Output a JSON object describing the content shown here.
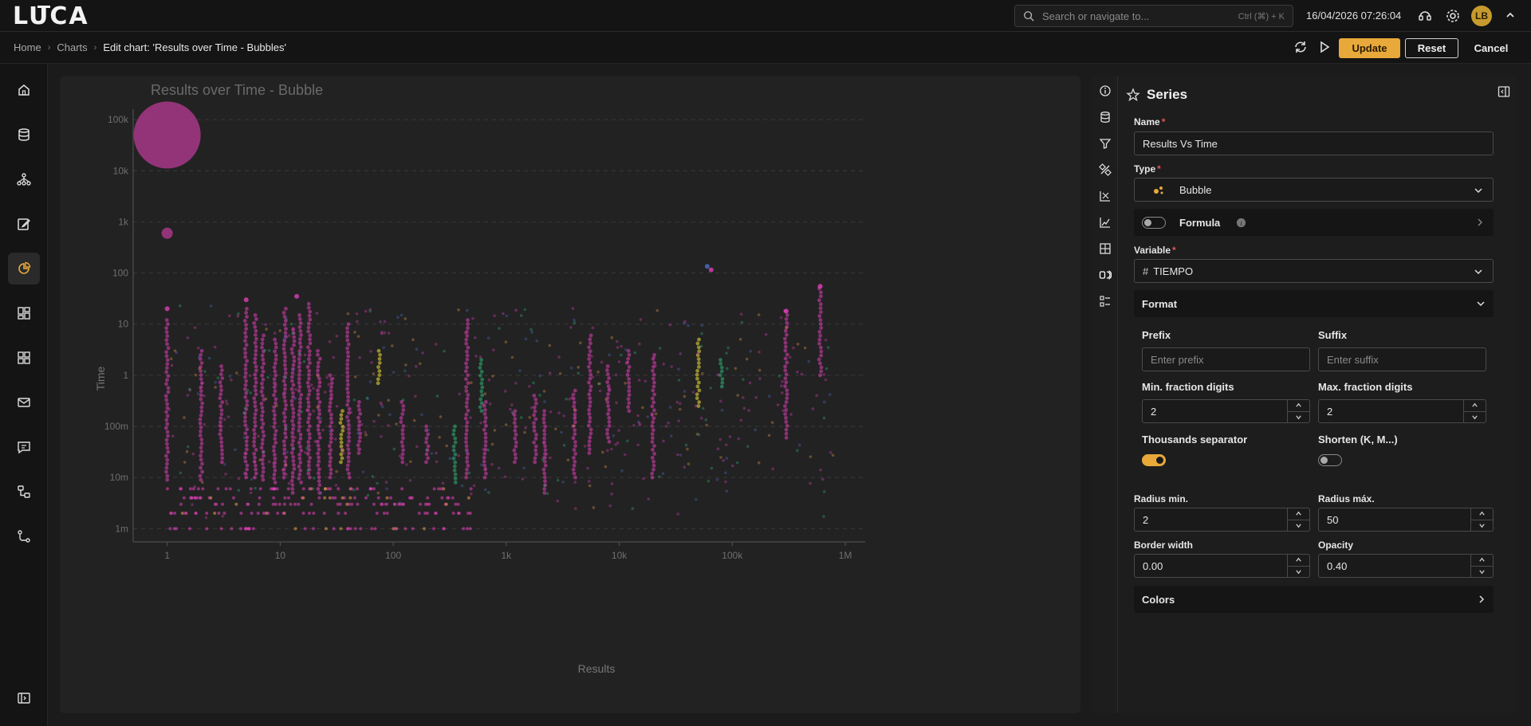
{
  "app": {
    "logo": "LUCA"
  },
  "topbar": {
    "search_placeholder": "Search or navigate to...",
    "search_shortcut": "Ctrl (⌘) + K",
    "datetime": "16/04/2026 07:26:04",
    "avatar_initials": "LB"
  },
  "breadcrumb": {
    "home": "Home",
    "charts": "Charts",
    "current": "Edit chart: 'Results over Time - Bubbles'"
  },
  "toolbar": {
    "update_label": "Update",
    "reset_label": "Reset",
    "cancel_label": "Cancel"
  },
  "chart_data": {
    "type": "scatter",
    "title": "Results over Time - Bubble",
    "xlabel": "Results",
    "ylabel": "Time",
    "xscale": "log",
    "yscale": "log",
    "xlim": [
      0.5,
      1500000
    ],
    "ylim": [
      0.00055,
      160000
    ],
    "x_ticks": [
      "1",
      "10",
      "100",
      "1k",
      "10k",
      "100k",
      "1M"
    ],
    "y_ticks": [
      "100k",
      "10k",
      "1k",
      "100",
      "10",
      "1",
      "100m",
      "10m",
      "1m"
    ],
    "grid": "horizontal-dashed",
    "colors": {
      "magenta": "#e040b8",
      "yellow": "#f2e23a",
      "green": "#2fb57a",
      "blue": "#4a70c8",
      "orange": "#e79a4a",
      "bigbubble": "#b03a8e"
    },
    "bubbles": [
      {
        "x": 1,
        "y": 50000,
        "r": 42,
        "color": "bigbubble"
      },
      {
        "x": 1,
        "y": 600,
        "r": 7,
        "color": "bigbubble"
      },
      {
        "x": 60000,
        "y": 135,
        "r": 3,
        "color": "blue"
      },
      {
        "x": 65000,
        "y": 115,
        "r": 3,
        "color": "magenta"
      },
      {
        "x": 600000,
        "y": 55,
        "r": 3,
        "color": "magenta"
      },
      {
        "x": 300000,
        "y": 18,
        "r": 3,
        "color": "magenta"
      },
      {
        "x": 1,
        "y": 20,
        "r": 3,
        "color": "magenta"
      },
      {
        "x": 5,
        "y": 30,
        "r": 3,
        "color": "magenta"
      },
      {
        "x": 14,
        "y": 35,
        "r": 3,
        "color": "magenta"
      }
    ],
    "columns": [
      {
        "x": 1,
        "ymin": 0.009,
        "ymax": 12,
        "color": "magenta"
      },
      {
        "x": 2,
        "ymin": 0.009,
        "ymax": 3,
        "color": "magenta"
      },
      {
        "x": 3,
        "ymin": 0.02,
        "ymax": 1.5,
        "color": "magenta"
      },
      {
        "x": 5,
        "ymin": 0.01,
        "ymax": 20,
        "color": "magenta"
      },
      {
        "x": 6,
        "ymin": 0.01,
        "ymax": 15,
        "color": "magenta"
      },
      {
        "x": 7,
        "ymin": 0.009,
        "ymax": 6,
        "color": "magenta"
      },
      {
        "x": 9,
        "ymin": 0.008,
        "ymax": 5,
        "color": "magenta"
      },
      {
        "x": 11,
        "ymin": 0.01,
        "ymax": 20,
        "color": "magenta"
      },
      {
        "x": 13,
        "ymin": 0.005,
        "ymax": 8,
        "color": "magenta"
      },
      {
        "x": 15,
        "ymin": 0.008,
        "ymax": 15,
        "color": "magenta"
      },
      {
        "x": 18,
        "ymin": 0.01,
        "ymax": 25,
        "color": "magenta"
      },
      {
        "x": 22,
        "ymin": 0.005,
        "ymax": 3,
        "color": "magenta"
      },
      {
        "x": 28,
        "ymin": 0.01,
        "ymax": 1,
        "color": "magenta"
      },
      {
        "x": 35,
        "ymin": 0.02,
        "ymax": 0.2,
        "color": "yellow"
      },
      {
        "x": 40,
        "ymin": 0.01,
        "ymax": 10,
        "color": "magenta"
      },
      {
        "x": 50,
        "ymin": 0.03,
        "ymax": 0.3,
        "color": "magenta"
      },
      {
        "x": 75,
        "ymin": 0.7,
        "ymax": 3,
        "color": "yellow"
      },
      {
        "x": 120,
        "ymin": 0.02,
        "ymax": 0.3,
        "color": "magenta"
      },
      {
        "x": 200,
        "ymin": 0.02,
        "ymax": 0.1,
        "color": "magenta"
      },
      {
        "x": 350,
        "ymin": 0.008,
        "ymax": 0.1,
        "color": "green"
      },
      {
        "x": 450,
        "ymin": 0.01,
        "ymax": 12,
        "color": "magenta"
      },
      {
        "x": 600,
        "ymin": 0.2,
        "ymax": 2,
        "color": "green"
      },
      {
        "x": 650,
        "ymin": 0.01,
        "ymax": 0.3,
        "color": "magenta"
      },
      {
        "x": 1200,
        "ymin": 0.02,
        "ymax": 0.2,
        "color": "magenta"
      },
      {
        "x": 1800,
        "ymin": 0.02,
        "ymax": 0.4,
        "color": "magenta"
      },
      {
        "x": 2200,
        "ymin": 0.005,
        "ymax": 0.2,
        "color": "magenta"
      },
      {
        "x": 4000,
        "ymin": 0.01,
        "ymax": 0.5,
        "color": "magenta"
      },
      {
        "x": 5500,
        "ymin": 0.03,
        "ymax": 6,
        "color": "magenta"
      },
      {
        "x": 8000,
        "ymin": 0.05,
        "ymax": 1.5,
        "color": "magenta"
      },
      {
        "x": 12000,
        "ymin": 0.2,
        "ymax": 3,
        "color": "magenta"
      },
      {
        "x": 20000,
        "ymin": 0.01,
        "ymax": 2.5,
        "color": "magenta"
      },
      {
        "x": 50000,
        "ymin": 0.25,
        "ymax": 5,
        "color": "yellow"
      },
      {
        "x": 80000,
        "ymin": 0.6,
        "ymax": 2,
        "color": "green"
      },
      {
        "x": 300000,
        "ymin": 0.06,
        "ymax": 18,
        "color": "magenta"
      },
      {
        "x": 600000,
        "ymin": 1,
        "ymax": 50,
        "color": "magenta"
      }
    ]
  },
  "panel": {
    "title": "Series",
    "name_label": "Name",
    "name_value": "Results Vs Time",
    "type_label": "Type",
    "type_value": "Bubble",
    "formula_label": "Formula",
    "variable_label": "Variable",
    "variable_value": "TIEMPO",
    "format_label": "Format",
    "prefix_label": "Prefix",
    "prefix_placeholder": "Enter prefix",
    "suffix_label": "Suffix",
    "suffix_placeholder": "Enter suffix",
    "min_frac_label": "Min. fraction digits",
    "min_frac_value": "2",
    "max_frac_label": "Max. fraction digits",
    "max_frac_value": "2",
    "thousands_label": "Thousands separator",
    "shorten_label": "Shorten (K, M...)",
    "radius_min_label": "Radius min.",
    "radius_min_value": "2",
    "radius_max_label": "Radius máx.",
    "radius_max_value": "50",
    "border_width_label": "Border width",
    "border_width_value": "0.00",
    "opacity_label": "Opacity",
    "opacity_value": "0.40",
    "colors_label": "Colors",
    "thousands_on": true,
    "shorten_on": false,
    "formula_on": false
  }
}
